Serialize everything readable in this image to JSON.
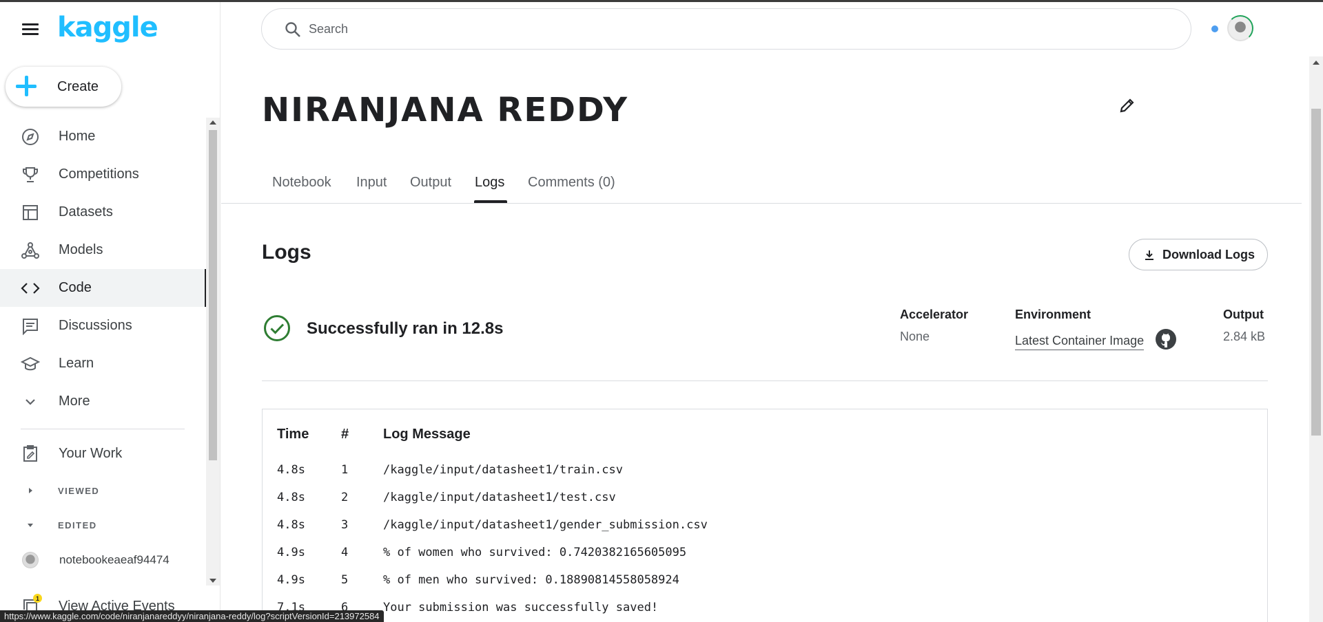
{
  "brand": {
    "logo_text": "kaggle",
    "accent": "#20beff"
  },
  "sidebar": {
    "create_label": "Create",
    "items": [
      {
        "label": "Home",
        "icon": "compass-icon"
      },
      {
        "label": "Competitions",
        "icon": "trophy-icon"
      },
      {
        "label": "Datasets",
        "icon": "table-icon"
      },
      {
        "label": "Models",
        "icon": "models-icon"
      },
      {
        "label": "Code",
        "icon": "code-icon",
        "active": true
      },
      {
        "label": "Discussions",
        "icon": "discussion-icon"
      },
      {
        "label": "Learn",
        "icon": "school-icon"
      },
      {
        "label": "More",
        "icon": "chevron-down-icon"
      }
    ],
    "your_work": "Your Work",
    "viewed": "VIEWED",
    "edited": "EDITED",
    "edited_item": "notebookeaeaf94474",
    "active_events": "View Active Events",
    "active_events_badge": "1"
  },
  "search": {
    "placeholder": "Search"
  },
  "notebook": {
    "title": "NIRANJANA REDDY"
  },
  "tabs": [
    "Notebook",
    "Input",
    "Output",
    "Logs",
    "Comments (0)"
  ],
  "active_tab": "Logs",
  "logs": {
    "heading": "Logs",
    "download_label": "Download Logs",
    "status": "Successfully ran in 12.8s",
    "accelerator_label": "Accelerator",
    "accelerator_value": "None",
    "environment_label": "Environment",
    "environment_value": "Latest Container Image",
    "output_label": "Output",
    "output_value": "2.84 kB",
    "columns": [
      "Time",
      "#",
      "Log Message"
    ],
    "rows": [
      {
        "time": "4.8s",
        "n": "1",
        "msg": "/kaggle/input/datasheet1/train.csv"
      },
      {
        "time": "4.8s",
        "n": "2",
        "msg": "/kaggle/input/datasheet1/test.csv"
      },
      {
        "time": "4.8s",
        "n": "3",
        "msg": "/kaggle/input/datasheet1/gender_submission.csv"
      },
      {
        "time": "4.9s",
        "n": "4",
        "msg": "% of women who survived: 0.7420382165605095"
      },
      {
        "time": "4.9s",
        "n": "5",
        "msg": "% of men who survived: 0.18890814558058924"
      },
      {
        "time": "7.1s",
        "n": "6",
        "msg": "Your submission was successfully saved!"
      }
    ]
  },
  "status_bar_url": "https://www.kaggle.com/code/niranjanareddyy/niranjana-reddy/log?scriptVersionId=213972584"
}
